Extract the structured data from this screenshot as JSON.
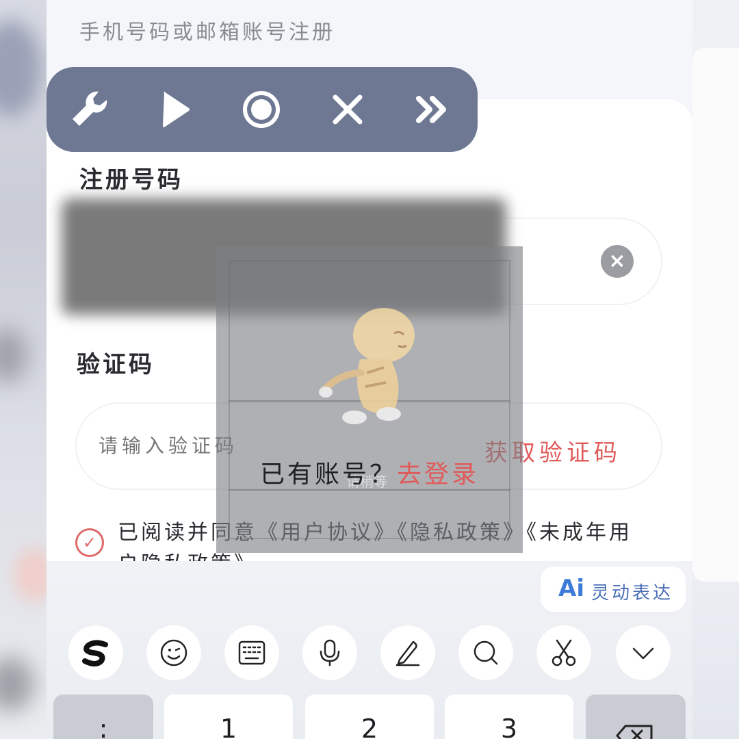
{
  "page": {
    "hint_title": "手机号码或邮箱账号注册",
    "phone_label": "注册号码",
    "code_label": "验证码",
    "code_placeholder": "请输入验证码",
    "get_code_label": "获取验证码",
    "login_prompt": "已有账号？",
    "login_link": "去登录",
    "agreement_text": "已阅读并同意《用户协议》《隐私政策》《未成年用户隐私政策》",
    "clear_symbol": "×",
    "overlay_caption": "请稍等"
  },
  "floating_toolbar": {
    "items": [
      {
        "icon": "wrench-icon"
      },
      {
        "icon": "play-icon"
      },
      {
        "icon": "record-icon"
      },
      {
        "icon": "close-icon"
      },
      {
        "icon": "fast-forward-icon"
      }
    ]
  },
  "keyboard": {
    "ai_chip": {
      "mark": "Ai",
      "label": "灵动表达"
    },
    "toolbar_icons": [
      "swype-logo-icon",
      "emoji-icon",
      "keyboard-icon",
      "microphone-icon",
      "handwriting-icon",
      "search-icon",
      "scissors-icon",
      "chevron-down-icon"
    ],
    "keys": [
      ":",
      "1",
      "2",
      "3"
    ]
  },
  "colors": {
    "accent_red": "#e05a5a",
    "toolbar_bg": "#6f7893",
    "ai_blue": "#3e7bd8"
  }
}
